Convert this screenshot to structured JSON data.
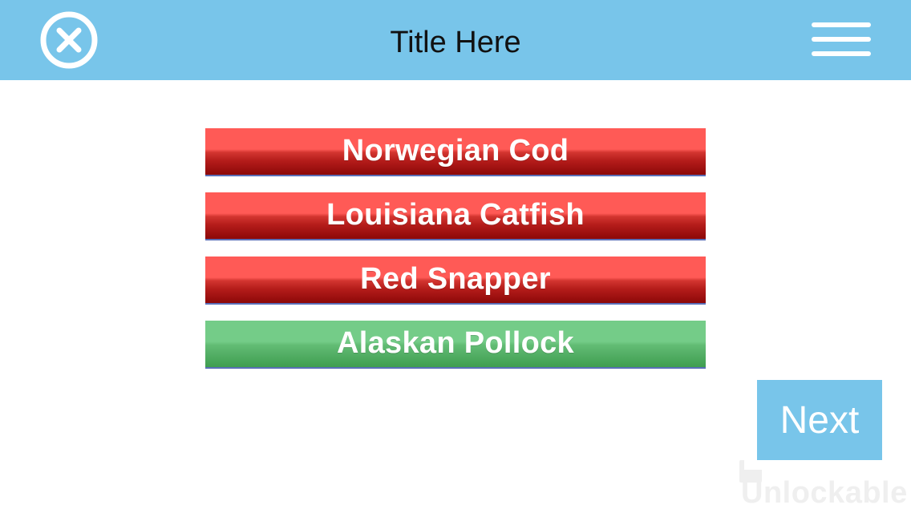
{
  "header": {
    "title": "Title Here",
    "close_icon": "close-circle-icon",
    "menu_icon": "hamburger-menu-icon",
    "background_color": "#78c5ea"
  },
  "answers": [
    {
      "label": "Norwegian Cod",
      "state": "wrong"
    },
    {
      "label": "Louisiana Catfish",
      "state": "wrong"
    },
    {
      "label": "Red Snapper",
      "state": "wrong"
    },
    {
      "label": "Alaskan Pollock",
      "state": "correct"
    }
  ],
  "colors": {
    "wrong": "#ff5a56",
    "correct": "#74cc88",
    "accent": "#78c5ea"
  },
  "next_button": {
    "label": "Next"
  },
  "watermark": {
    "text": "Unlockable"
  }
}
